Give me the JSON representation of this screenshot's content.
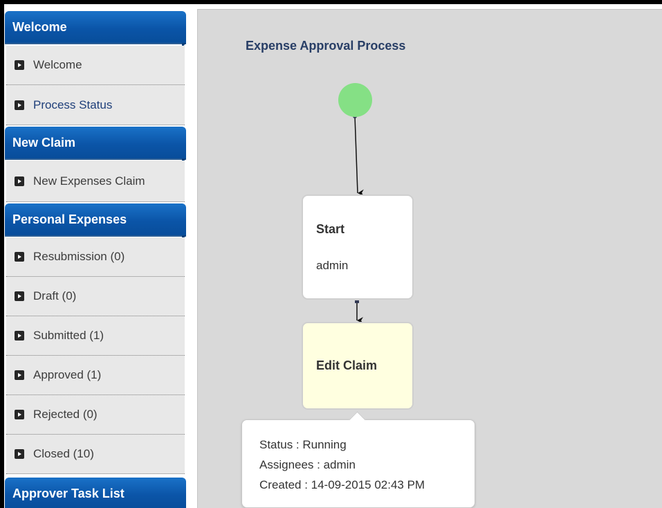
{
  "sidebar": {
    "sections": [
      {
        "title": "Welcome",
        "items": [
          {
            "label": "Welcome"
          },
          {
            "label": "Process Status",
            "active": true
          }
        ]
      },
      {
        "title": "New Claim",
        "items": [
          {
            "label": "New Expenses Claim"
          }
        ]
      },
      {
        "title": "Personal Expenses",
        "items": [
          {
            "label": "Resubmission (0)"
          },
          {
            "label": "Draft (0)"
          },
          {
            "label": "Submitted (1)"
          },
          {
            "label": "Approved (1)"
          },
          {
            "label": "Rejected (0)"
          },
          {
            "label": "Closed (10)"
          }
        ]
      },
      {
        "title": "Approver Task List",
        "items": []
      }
    ],
    "item_icon": "play-square-icon"
  },
  "process": {
    "title": "Expense Approval Process",
    "start_event_color": "#85e085",
    "tasks": [
      {
        "name": "Start",
        "assignee": "admin"
      },
      {
        "name": "Edit Claim",
        "assignee": ""
      }
    ]
  },
  "tooltip": {
    "status": "Status : Running",
    "assignees": "Assignees : admin",
    "created": "Created : 14-09-2015 02:43 PM"
  },
  "colors": {
    "header_blue": "#0b55a8",
    "active_link": "#1f3f7a",
    "task_highlight": "#ffffe0"
  }
}
